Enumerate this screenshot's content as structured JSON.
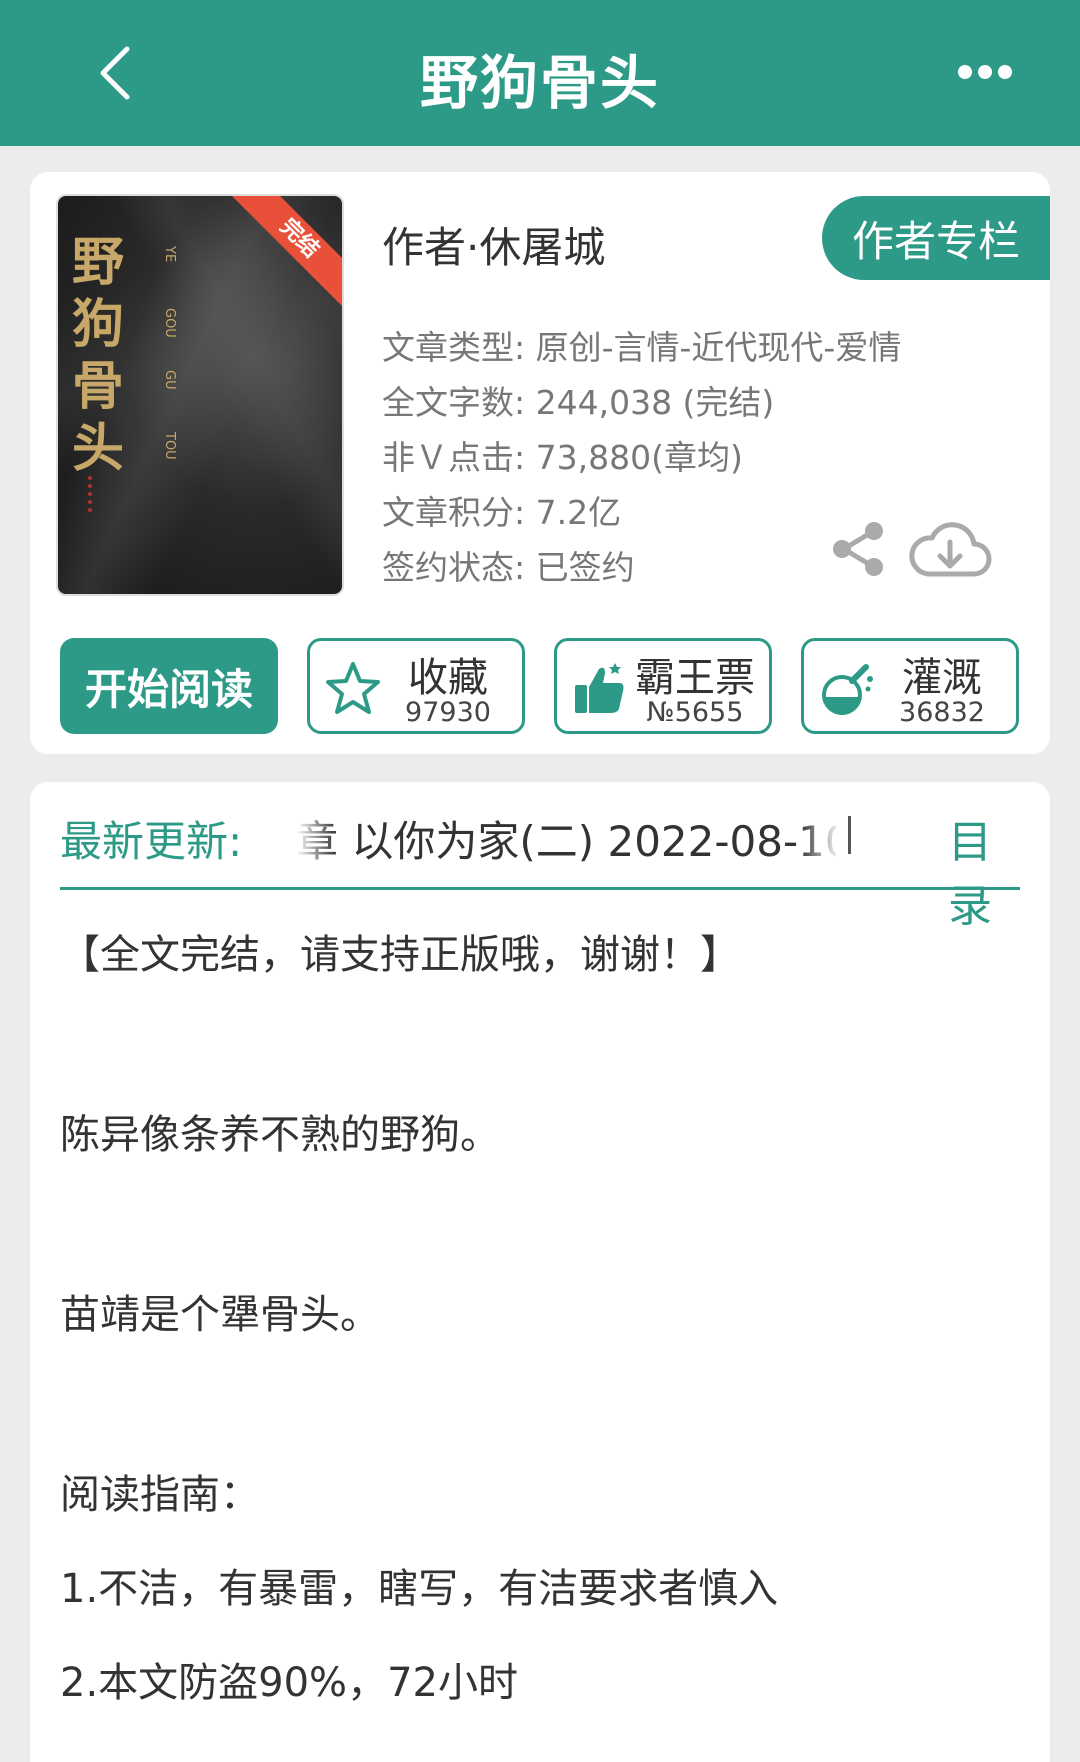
{
  "header": {
    "title": "野狗骨头"
  },
  "book": {
    "cover": {
      "title_chars": [
        "野",
        "狗",
        "骨",
        "头"
      ],
      "pinyin": [
        "YE",
        "GOU",
        "GU",
        "TOU"
      ],
      "ribbon": "完结"
    },
    "author": "作者·休屠城",
    "author_column_button": "作者专栏",
    "meta": [
      "文章类型: 原创-言情-近代现代-爱情",
      "全文字数: 244,038 (完结)",
      "非Ｖ点击: 73,880(章均)",
      "文章积分: 7.2亿",
      "签约状态:  已签约"
    ]
  },
  "actions": {
    "read": "开始阅读",
    "collect": {
      "label": "收藏",
      "count": "97930"
    },
    "ticket": {
      "label": "霸王票",
      "count": "№5655"
    },
    "nutrient": {
      "label": "灌溉",
      "count": "36832"
    }
  },
  "update": {
    "label": "最新更新:",
    "text": "章  以你为家(二)  2022-08-10",
    "toc": "目录"
  },
  "description": [
    "【全文完结，请支持正版哦，谢谢！】",
    "陈异像条养不熟的野狗。",
    "苗靖是个犟骨头。",
    "阅读指南：",
    "1.不洁，有暴雷，瞎写，有洁要求者慎入",
    "2.本文防盗90%，72小时"
  ],
  "colors": {
    "brand": "#2d9a87",
    "ribbon": "#e8503a"
  }
}
